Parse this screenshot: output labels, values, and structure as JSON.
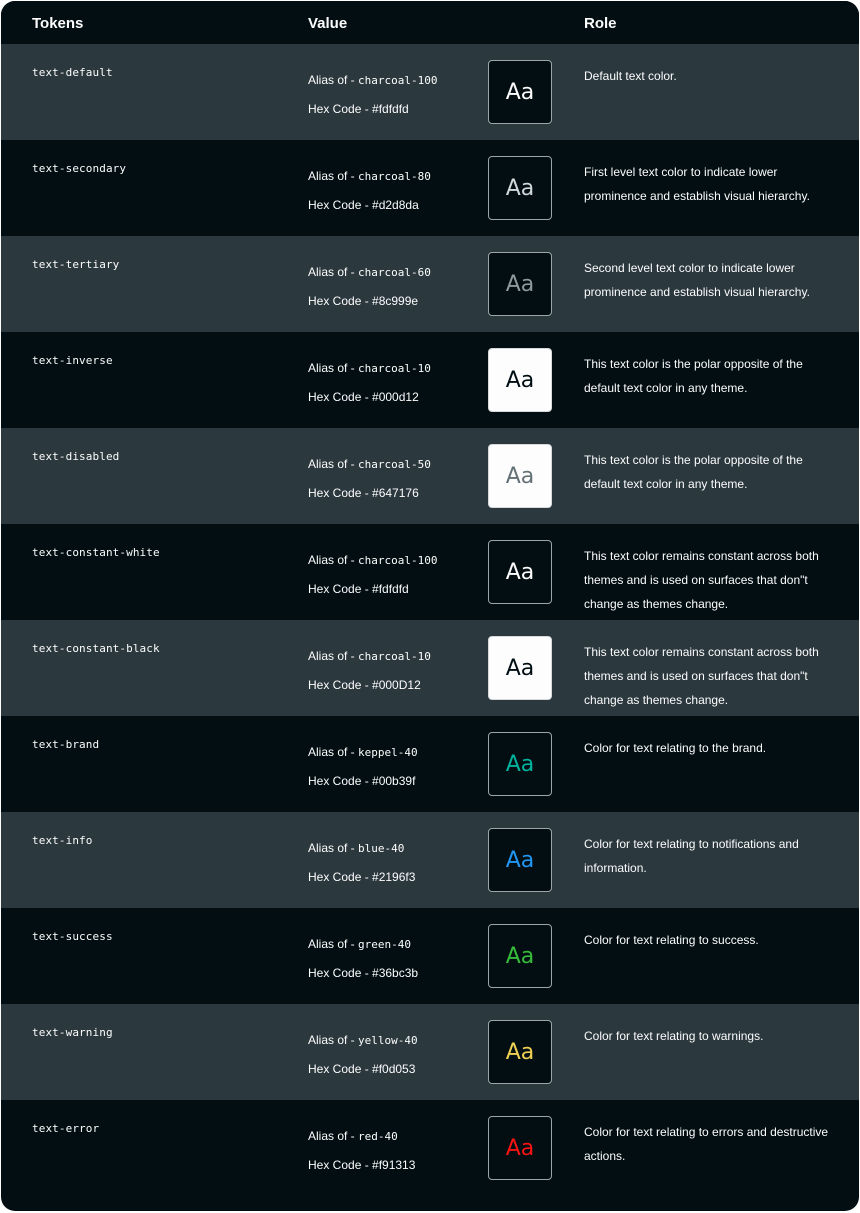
{
  "header": {
    "tokens": "Tokens",
    "value": "Value",
    "role": "Role"
  },
  "alias_prefix": "Alias of - ",
  "hex_prefix": "Hex Code - ",
  "sample_text": "Aa",
  "rows": [
    {
      "token": "text-default",
      "alias": "charcoal-100",
      "hex": "#fdfdfd",
      "sample_color": "#fdfdfd",
      "swatch_bg": "dark",
      "role": "Default text color."
    },
    {
      "token": "text-secondary",
      "alias": "charcoal-80",
      "hex": "#d2d8da",
      "sample_color": "#d2d8da",
      "swatch_bg": "dark",
      "role": "First level text color to indicate lower prominence and establish visual hierarchy."
    },
    {
      "token": "text-tertiary",
      "alias": "charcoal-60",
      "hex": "#8c999e",
      "sample_color": "#8c999e",
      "swatch_bg": "dark",
      "role": "Second level text color to indicate lower prominence and establish visual hierarchy."
    },
    {
      "token": "text-inverse",
      "alias": "charcoal-10",
      "hex": "#000d12",
      "sample_color": "#000d12",
      "swatch_bg": "light",
      "role": "This text color is the polar opposite of the default text color in any theme."
    },
    {
      "token": "text-disabled",
      "alias": "charcoal-50",
      "hex": "#647176",
      "sample_color": "#647176",
      "swatch_bg": "light",
      "role": "This text color is the polar opposite of the default text color in any theme."
    },
    {
      "token": "text-constant-white",
      "alias": "charcoal-100",
      "hex": "#fdfdfd",
      "sample_color": "#fdfdfd",
      "swatch_bg": "dark",
      "role": "This text color remains constant across both themes and is used on surfaces that don\"t change as themes change."
    },
    {
      "token": "text-constant-black",
      "alias": "charcoal-10",
      "hex": "#000D12",
      "sample_color": "#000d12",
      "swatch_bg": "light",
      "role": "This text color remains constant across both themes and is used on surfaces that don\"t change as themes change."
    },
    {
      "token": "text-brand",
      "alias": "keppel-40",
      "hex": "#00b39f",
      "sample_color": "#00b39f",
      "swatch_bg": "dark",
      "role": "Color for text relating to the brand."
    },
    {
      "token": "text-info",
      "alias": "blue-40",
      "hex": "#2196f3",
      "sample_color": "#2196f3",
      "swatch_bg": "dark",
      "role": "Color for text relating to notifications and information."
    },
    {
      "token": "text-success",
      "alias": "green-40",
      "hex": "#36bc3b",
      "sample_color": "#36bc3b",
      "swatch_bg": "dark",
      "role": "Color for text relating to success."
    },
    {
      "token": "text-warning",
      "alias": "yellow-40",
      "hex": "#f0d053",
      "sample_color": "#f0d053",
      "swatch_bg": "dark",
      "role": "Color for text relating to warnings."
    },
    {
      "token": "text-error",
      "alias": "red-40",
      "hex": "#f91313",
      "sample_color": "#f91313",
      "swatch_bg": "dark",
      "role": "Color for text relating to errors and destructive actions."
    }
  ]
}
